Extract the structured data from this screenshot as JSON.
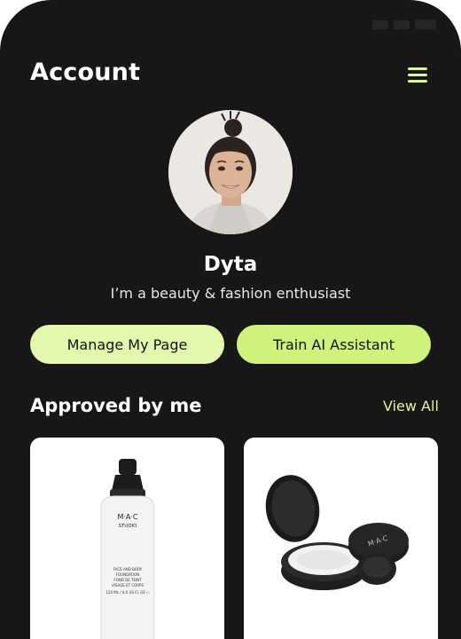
{
  "header": {
    "title": "Account"
  },
  "profile": {
    "name": "Dyta",
    "bio": "I’m a beauty & fashion enthusiast"
  },
  "actions": {
    "manage_label": "Manage My Page",
    "train_label": "Train AI Assistant"
  },
  "approved": {
    "title": "Approved by me",
    "view_all": "View All",
    "products": [
      {
        "brand": "M·A·C",
        "line": "STUDIO",
        "text1": "FACE AND BODY",
        "text2": "FOUNDATION",
        "text3": "FOND DE TEINT",
        "text4": "VISAGE ET CORPS",
        "size": "120 ML / 4.0 US FL OZ ℮"
      },
      {
        "brand": "M·A·C"
      }
    ]
  },
  "colors": {
    "background": "#171717",
    "accent": "#dff59a",
    "button_light": "#e4f8ad",
    "button_green": "#cff27a"
  }
}
